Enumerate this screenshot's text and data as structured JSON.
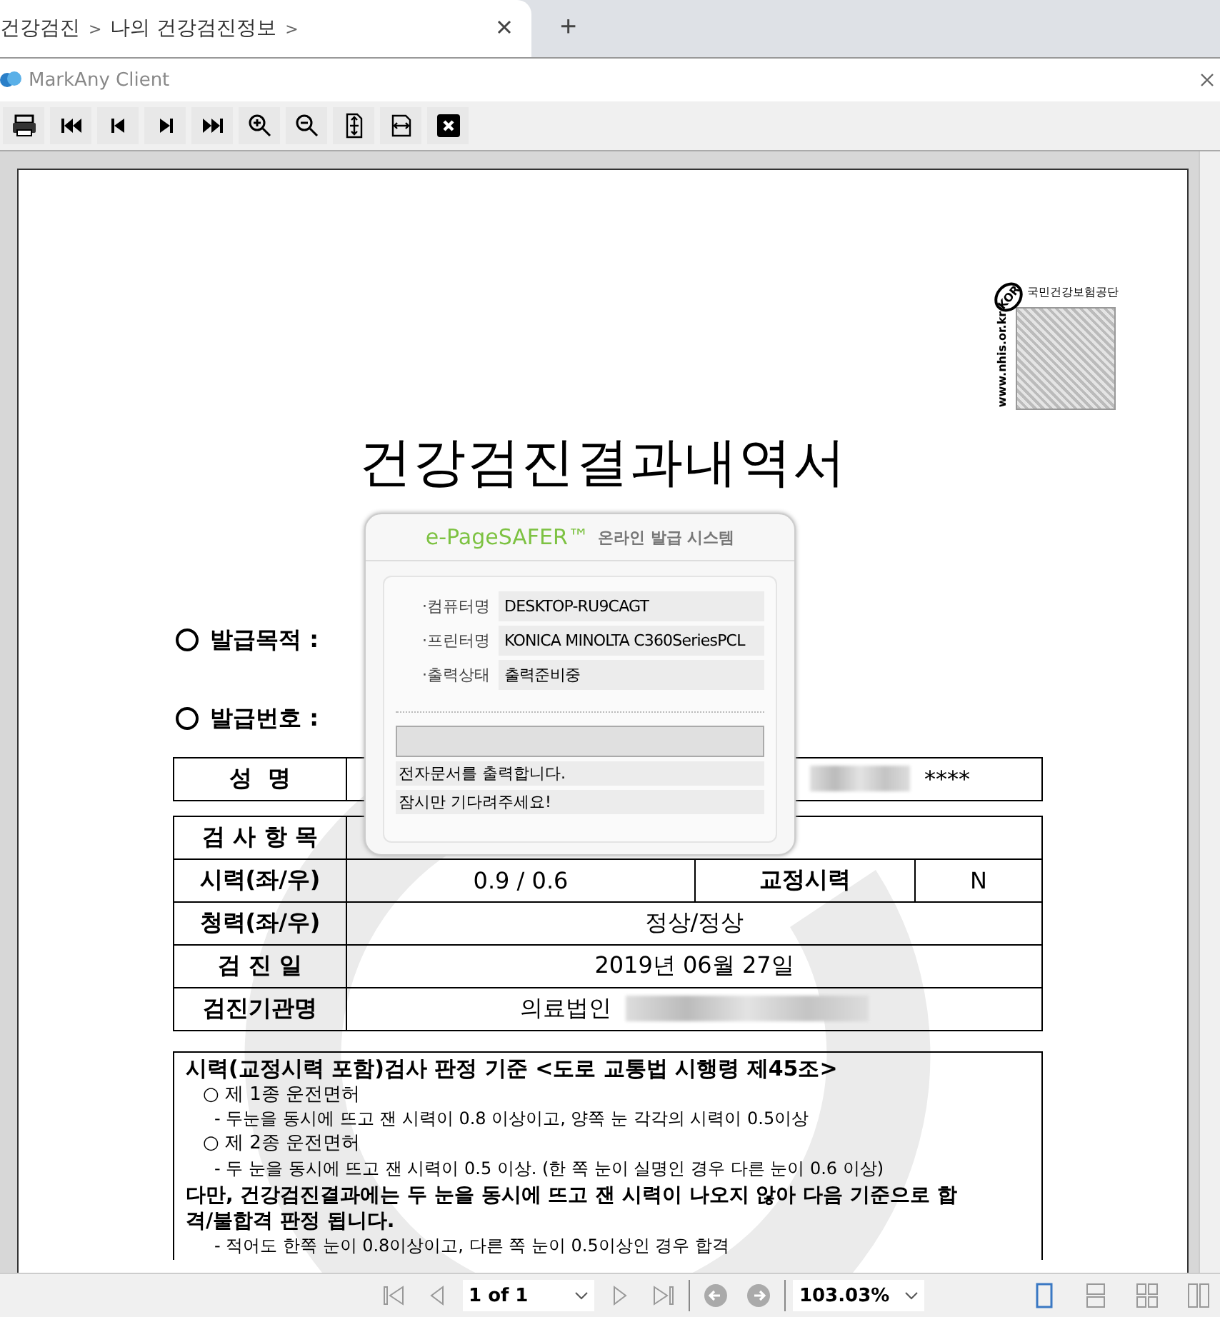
{
  "browser_tab": {
    "crumbs": [
      "건강검진",
      "나의 건강검진정보"
    ],
    "separator": ">",
    "selected": true
  },
  "new_tab": "+",
  "client_window": {
    "title": "MarkAny Client"
  },
  "document": {
    "stamp": {
      "badge": "KOR",
      "org": "국민건강보험공단",
      "url": "www.nhis.or.kr"
    },
    "title": "건강검진결과내역서",
    "fields": [
      {
        "label": "발급목적 :"
      },
      {
        "label": "발급번호 :"
      }
    ],
    "name_row": {
      "label": "성  명",
      "masked": "****"
    },
    "rows": [
      {
        "kind": "covered",
        "label": "검 사 항 목"
      },
      {
        "kind": "split",
        "label": "시력(좌/우)",
        "value": "0.9 / 0.6",
        "label2": "교정시력",
        "value2": "N"
      },
      {
        "kind": "plain",
        "label": "청력(좌/우)",
        "value": "정상/정상"
      },
      {
        "kind": "plain",
        "label": "검 진 일",
        "value": "2019년 06월 27일"
      },
      {
        "kind": "blurred",
        "label": "검진기관명",
        "value": "의료법인"
      }
    ],
    "criteria": {
      "heading": "시력(교정시력 포함)검사 판정 기준 <도로 교통법 시행령 제45조>",
      "items": [
        {
          "kind": "license",
          "text": "○ 제 1종 운전면허"
        },
        {
          "kind": "detail",
          "text": "- 두눈을 동시에 뜨고 잰 시력이 0.8 이상이고, 양쪽 눈 각각의 시력이 0.5이상"
        },
        {
          "kind": "license",
          "text": "○ 제 2종 운전면허"
        },
        {
          "kind": "detail",
          "text": "- 두 눈을 동시에 뜨고 잰 시력이 0.5 이상. (한 쪽 눈이 실명인 경우 다른 눈이 0.6 이상)"
        },
        {
          "kind": "note",
          "text": "다만, 건강검진결과에는 두 눈을  동시에 뜨고 잰 시력이 나오지 않아 다음 기준으로 합격/불합격 판정 됩니다."
        },
        {
          "kind": "detail",
          "text": "- 적어도 한쪽 눈이 0.8이상이고, 다른 쪽 눈이 0.5이상인 경우 합격"
        }
      ]
    }
  },
  "dialog": {
    "brand": "e-PageSAFER™",
    "subtitle": "온라인 발급 시스템",
    "info": [
      {
        "label": "·컴퓨터명",
        "value": "DESKTOP-RU9CAGT"
      },
      {
        "label": "·프린터명",
        "value": "KONICA MINOLTA C360SeriesPCL"
      },
      {
        "label": "·출력상태",
        "value": "출력준비중"
      }
    ],
    "progress": {
      "level": 0
    },
    "messages": [
      "전자문서를 출력합니다.",
      "잠시만 기다려주세요!"
    ]
  },
  "status_bar": {
    "page": "1 of 1",
    "zoom": "103.03%",
    "view_modes": [
      {
        "kind": "single",
        "selected": true
      },
      {
        "kind": "continuous",
        "selected": false
      },
      {
        "kind": "grid",
        "selected": false
      },
      {
        "kind": "facing",
        "selected": false
      }
    ]
  }
}
